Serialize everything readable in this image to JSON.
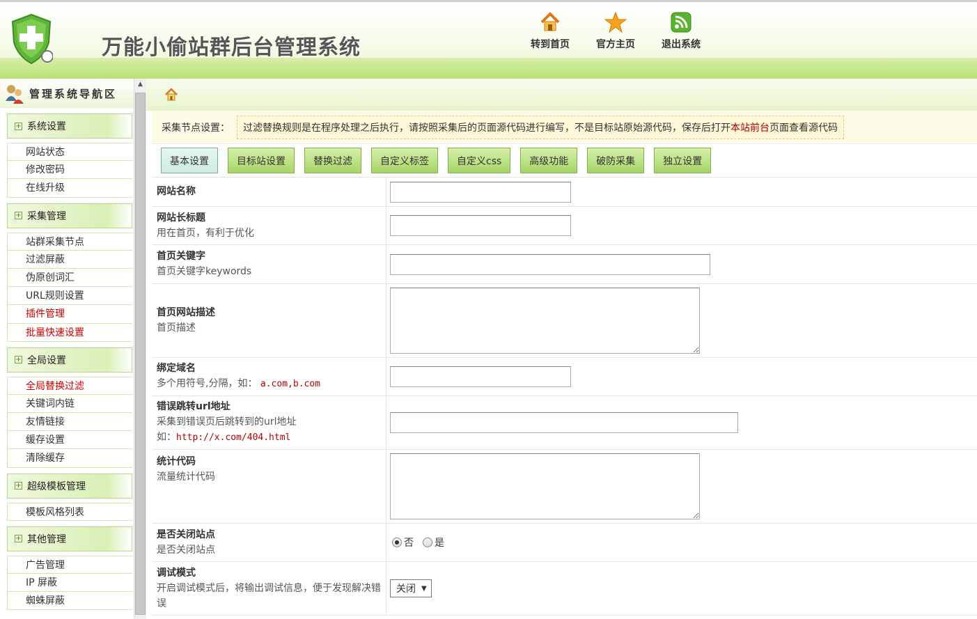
{
  "header": {
    "title": "万能小偷站群后台管理系统",
    "nav": [
      {
        "label": "转到首页",
        "icon": "home-icon"
      },
      {
        "label": "官方主页",
        "icon": "star-icon"
      },
      {
        "label": "退出系统",
        "icon": "rss-icon"
      }
    ]
  },
  "sidebar": {
    "heading": "管理系统导航区",
    "groups": [
      {
        "label": "系统设置",
        "items": [
          "网站状态",
          "修改密码",
          "在线升级"
        ]
      },
      {
        "label": "采集管理",
        "items": [
          "站群采集节点",
          "过滤屏蔽",
          "伪原创词汇",
          "URL规则设置",
          "插件管理",
          "批量快速设置"
        ]
      },
      {
        "label": "全局设置",
        "items": [
          "全局替换过滤",
          "关键词内链",
          "友情链接",
          "缓存设置",
          "清除缓存"
        ]
      },
      {
        "label": "超级模板管理",
        "items": [
          "模板风格列表"
        ]
      },
      {
        "label": "其他管理",
        "items": [
          "广告管理",
          "IP 屏蔽",
          "蜘蛛屏蔽"
        ]
      }
    ]
  },
  "notice": {
    "label": "采集节点设置：",
    "text_before": "过滤替换规则是在程序处理之后执行，请按照采集后的页面源代码进行编写，不是目标站原始源代码，保存后打开",
    "link": "本站前台",
    "text_after": "页面查看源代码"
  },
  "tabs": [
    "基本设置",
    "目标站设置",
    "替换过滤",
    "自定义标签",
    "自定义css",
    "高级功能",
    "破防采集",
    "独立设置"
  ],
  "form": {
    "site_name": {
      "title": "网站名称",
      "value": ""
    },
    "long_title": {
      "title": "网站长标题",
      "desc": "用在首页，有利于优化",
      "value": ""
    },
    "keywords": {
      "title": "首页关键字",
      "desc": "首页关键字keywords",
      "value": ""
    },
    "description": {
      "title": "首页网站描述",
      "desc": "首页描述",
      "value": ""
    },
    "domain": {
      "title": "绑定域名",
      "desc": "多个用符号,分隔，如：",
      "example": "a.com,b.com",
      "value": ""
    },
    "error_url": {
      "title": "错误跳转url地址",
      "desc": "采集到错误页后跳转到的url地址",
      "desc2": "如：",
      "example": "http://x.com/404.html",
      "value": ""
    },
    "stats": {
      "title": "统计代码",
      "desc": "流量统计代码",
      "value": ""
    },
    "close_site": {
      "title": "是否关闭站点",
      "desc": "是否关闭站点",
      "options": [
        "否",
        "是"
      ],
      "selected": "否"
    },
    "debug": {
      "title": "调试模式",
      "desc": "开启调试模式后，将输出调试信息，便于发现解决错误",
      "value": "关闭"
    }
  }
}
